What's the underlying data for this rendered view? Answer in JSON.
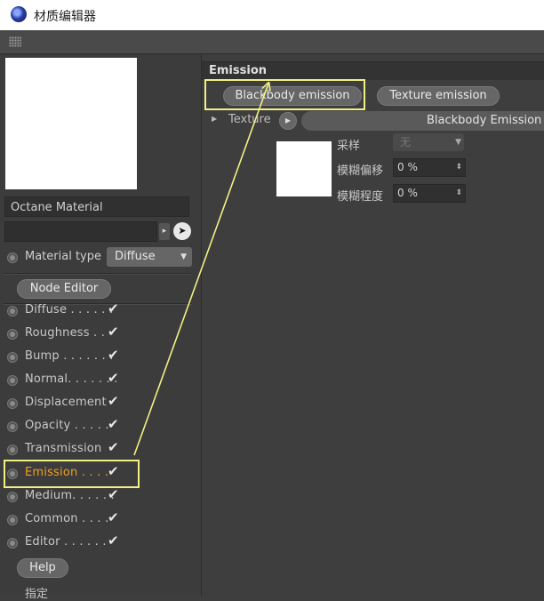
{
  "window": {
    "title": "材质编辑器",
    "icon": "app-logo-icon"
  },
  "left_panel": {
    "material_name": "Octane Material",
    "material_type_label": "Material type",
    "material_type_value": "Diffuse",
    "node_editor_label": "Node Editor",
    "channels": [
      {
        "label": "Diffuse . . . . . .",
        "checked": "✔"
      },
      {
        "label": "Roughness . .",
        "checked": "✔"
      },
      {
        "label": "Bump . . . . . . .",
        "checked": "✔"
      },
      {
        "label": "Normal. . . . . . .",
        "checked": "✔"
      },
      {
        "label": "Displacement",
        "checked": "✔"
      },
      {
        "label": "Opacity . . . . .",
        "checked": "✔"
      },
      {
        "label": "Transmission",
        "checked": "✔"
      },
      {
        "label": "Emission . . . .",
        "checked": "✔",
        "active": true
      },
      {
        "label": "Medium. . . . . .",
        "checked": "✔"
      },
      {
        "label": "Common . . . .",
        "checked": "✔"
      },
      {
        "label": "Editor . . . . . .",
        "checked": "✔"
      }
    ],
    "help_label": "Help",
    "assign_label": "指定"
  },
  "right_panel": {
    "section_title": "Emission",
    "blackbody_button": "Blackbody emission",
    "texture_emission_button": "Texture emission",
    "texture_label": "Texture",
    "texture_name": "Blackbody Emission",
    "sample_label": "采样",
    "sample_value": "无",
    "blur_offset_label": "模糊偏移",
    "blur_offset_value": "0 %",
    "blur_degree_label": "模糊程度",
    "blur_degree_value": "0 %"
  },
  "colors": {
    "accent_active": "#f0a020",
    "annotation": "#f2f083"
  }
}
